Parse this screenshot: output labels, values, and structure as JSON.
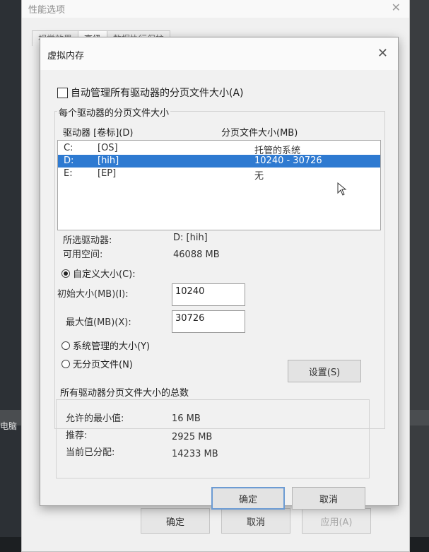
{
  "desktop": {
    "side_text": "电脑"
  },
  "perf": {
    "title": "性能选项",
    "close": "✕",
    "tabs": [
      "视觉效果",
      "高级",
      "数据执行保护"
    ],
    "ok": "确定",
    "cancel": "取消",
    "apply": "应用(A)"
  },
  "vm": {
    "title": "虚拟内存",
    "close": "✕",
    "auto_manage": "自动管理所有驱动器的分页文件大小(A)",
    "auto_manage_checked": false,
    "group_title": "每个驱动器的分页文件大小",
    "col_drive": "驱动器 [卷标](D)",
    "col_size": "分页文件大小(MB)",
    "drives": [
      {
        "letter": "C:",
        "label": "[OS]",
        "size": "托管的系统",
        "selected": false
      },
      {
        "letter": "D:",
        "label": "[hih]",
        "size": "10240 - 30726",
        "selected": true
      },
      {
        "letter": "E:",
        "label": "[EP]",
        "size": "无",
        "selected": false
      }
    ],
    "selected_drive_label": "所选驱动器:",
    "selected_drive_value": "D:  [hih]",
    "free_space_label": "可用空间:",
    "free_space_value": "46088 MB",
    "custom_size": "自定义大小(C):",
    "initial_label": "初始大小(MB)(I):",
    "initial_value": "10240",
    "max_label": "最大值(MB)(X):",
    "max_value": "30726",
    "system_managed": "系统管理的大小(Y)",
    "no_paging": "无分页文件(N)",
    "set_button": "设置(S)",
    "totals_title": "所有驱动器分页文件大小的总数",
    "min_allowed_label": "允许的最小值:",
    "min_allowed_value": "16 MB",
    "recommended_label": "推荐:",
    "recommended_value": "2925 MB",
    "allocated_label": "当前已分配:",
    "allocated_value": "14233 MB",
    "ok": "确定",
    "cancel": "取消"
  }
}
